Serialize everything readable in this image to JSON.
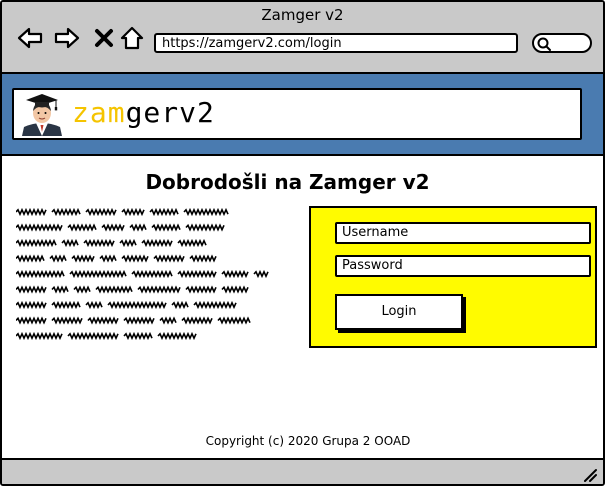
{
  "window": {
    "title": "Zamger v2",
    "address": "https://zamgerv2.com/login",
    "nav_icons": [
      "back-arrow-icon",
      "forward-arrow-icon",
      "close-x-icon",
      "home-icon"
    ],
    "search_icon": "magnifier-icon"
  },
  "header": {
    "logo_part1": "zam",
    "logo_part2": "gerv2",
    "band_color": "#4a7bb0",
    "logo_accent": "#f5c400",
    "avatar_icon": "graduate-avatar-icon"
  },
  "main": {
    "title": "Dobrodošli na Zamger v2",
    "lorem_lines": 8,
    "login": {
      "panel_color": "#fffb00",
      "username_placeholder": "Username",
      "password_placeholder": "Password",
      "button_label": "Login"
    }
  },
  "footer": {
    "copyright": "Copyright (c) 2020 Grupa 2 OOAD"
  }
}
